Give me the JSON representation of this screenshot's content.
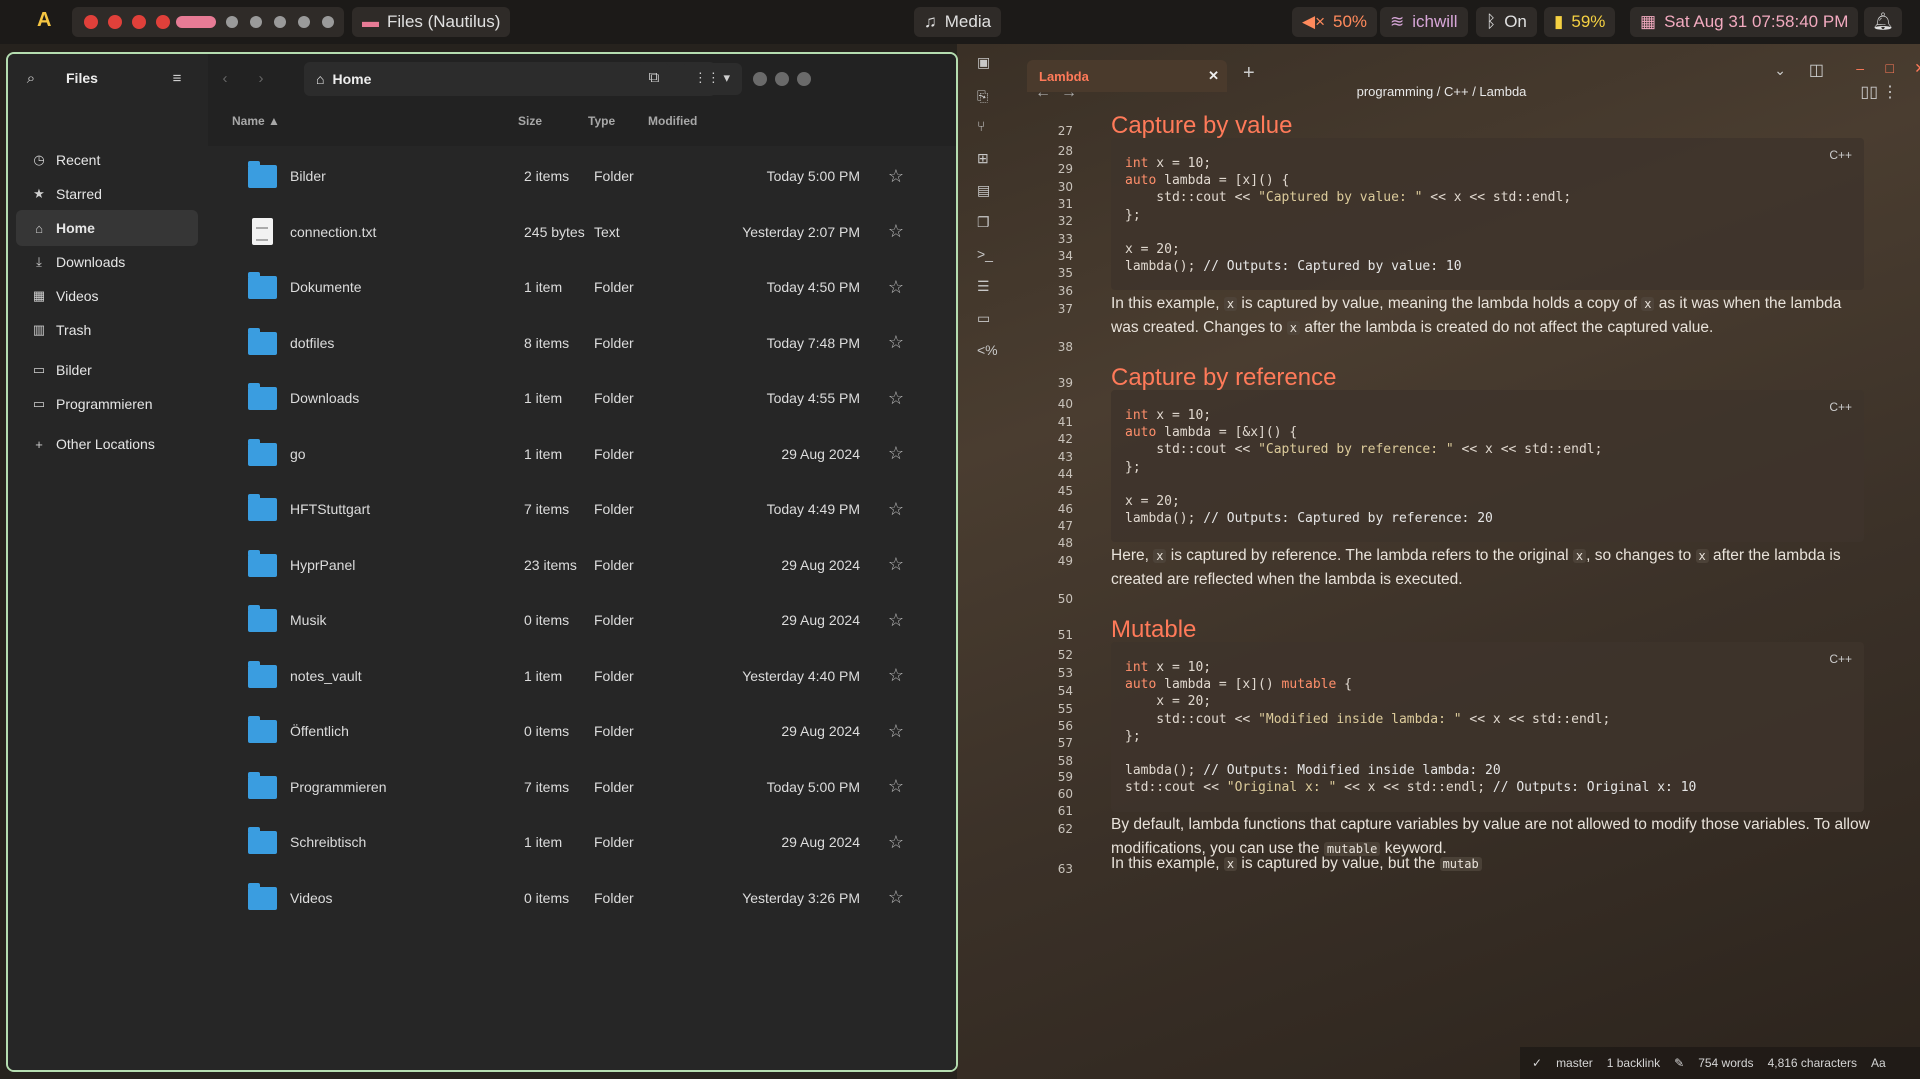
{
  "topbar": {
    "launcher": "A",
    "window_title": "Files (Nautilus)",
    "media": "Media",
    "volume": "50%",
    "wifi": "ichwill",
    "bluetooth": "On",
    "battery": "59%",
    "datetime": "Sat Aug 31  07:58:40 PM",
    "colors": {
      "red": "#e0403a",
      "pink": "#e77b95",
      "gray": "#9a9a9a"
    }
  },
  "files": {
    "title": "Files",
    "path": "Home",
    "sidebar": [
      {
        "label": "Recent",
        "icon": "clock-icon"
      },
      {
        "label": "Starred",
        "icon": "star-icon"
      },
      {
        "label": "Home",
        "icon": "home-icon"
      },
      {
        "label": "Downloads",
        "icon": "download-icon"
      },
      {
        "label": "Videos",
        "icon": "video-icon"
      },
      {
        "label": "Trash",
        "icon": "trash-icon"
      },
      {
        "label": "Bilder",
        "icon": "bookmark-folder-icon"
      },
      {
        "label": "Programmieren",
        "icon": "bookmark-folder-icon"
      },
      {
        "label": "Other Locations",
        "icon": "plus-icon"
      }
    ],
    "columns": {
      "name": "Name",
      "size": "Size",
      "type": "Type",
      "modified": "Modified"
    },
    "rows": [
      {
        "name": "Bilder",
        "size": "2 items",
        "type": "Folder",
        "modified": "Today 5:00 PM"
      },
      {
        "name": "connection.txt",
        "size": "245 bytes",
        "type": "Text",
        "modified": "Yesterday 2:07 PM"
      },
      {
        "name": "Dokumente",
        "size": "1 item",
        "type": "Folder",
        "modified": "Today 4:50 PM"
      },
      {
        "name": "dotfiles",
        "size": "8 items",
        "type": "Folder",
        "modified": "Today 7:48 PM"
      },
      {
        "name": "Downloads",
        "size": "1 item",
        "type": "Folder",
        "modified": "Today 4:55 PM"
      },
      {
        "name": "go",
        "size": "1 item",
        "type": "Folder",
        "modified": "29 Aug 2024"
      },
      {
        "name": "HFTStuttgart",
        "size": "7 items",
        "type": "Folder",
        "modified": "Today 4:49 PM"
      },
      {
        "name": "HyprPanel",
        "size": "23 items",
        "type": "Folder",
        "modified": "29 Aug 2024"
      },
      {
        "name": "Musik",
        "size": "0 items",
        "type": "Folder",
        "modified": "29 Aug 2024"
      },
      {
        "name": "notes_vault",
        "size": "1 item",
        "type": "Folder",
        "modified": "Yesterday 4:40 PM"
      },
      {
        "name": "Öffentlich",
        "size": "0 items",
        "type": "Folder",
        "modified": "29 Aug 2024"
      },
      {
        "name": "Programmieren",
        "size": "7 items",
        "type": "Folder",
        "modified": "Today 5:00 PM"
      },
      {
        "name": "Schreibtisch",
        "size": "1 item",
        "type": "Folder",
        "modified": "29 Aug 2024"
      },
      {
        "name": "Videos",
        "size": "0 items",
        "type": "Folder",
        "modified": "Yesterday 3:26 PM"
      }
    ]
  },
  "editor": {
    "tab": "Lambda",
    "breadcrumb": "programming / C++ / Lambda",
    "lang": "C++",
    "h_value": "Capture by value",
    "h_ref": "Capture by reference",
    "h_mut": "Mutable",
    "code_value": [
      "int x = 10;",
      "auto lambda = [x]() {",
      "    std::cout << \"Captured by value: \" << x << std::endl;",
      "};",
      "",
      "x = 20;",
      "lambda(); // Outputs: Captured by value: 10"
    ],
    "code_ref": [
      "int x = 10;",
      "auto lambda = [&x]() {",
      "    std::cout << \"Captured by reference: \" << x << std::endl;",
      "};",
      "",
      "x = 20;",
      "lambda(); // Outputs: Captured by reference: 20"
    ],
    "code_mut": [
      "int x = 10;",
      "auto lambda = [x]() mutable {",
      "    x = 20;",
      "    std::cout << \"Modified inside lambda: \" << x << std::endl;",
      "};",
      "",
      "lambda(); // Outputs: Modified inside lambda: 20",
      "std::cout << \"Original x: \" << x << std::endl; // Outputs: Original x: 10"
    ],
    "p_value": [
      "In this example, ",
      "x",
      " is captured by value, meaning the lambda holds a copy of ",
      "x",
      " as it was when the lambda was created. Changes to ",
      "x",
      " after the lambda is created do not affect the captured value."
    ],
    "p_ref": [
      "Here, ",
      "x",
      " is captured by reference. The lambda refers to the original ",
      "x",
      ", so changes to ",
      "x",
      " after the lambda is created are reflected when the lambda is executed."
    ],
    "p_mut": [
      "By default, lambda functions that capture variables by value are not allowed to modify those variables. To allow modifications, you can use the ",
      "mutable",
      " keyword."
    ],
    "p_last": [
      "In this example, ",
      "x",
      " is captured by value, but the ",
      "mutab"
    ],
    "line_numbers": [
      "27",
      "28",
      "29",
      "30",
      "31",
      "32",
      "33",
      "34",
      "35",
      "36",
      "37",
      "38",
      "39",
      "40",
      "41",
      "42",
      "43",
      "44",
      "45",
      "46",
      "47",
      "48",
      "49",
      "50",
      "51",
      "52",
      "53",
      "54",
      "55",
      "56",
      "57",
      "58",
      "59",
      "60",
      "61",
      "62",
      "63"
    ],
    "status": {
      "branch": "master",
      "backlinks": "1 backlink",
      "words": "754 words",
      "chars": "4,816 characters",
      "font": "Aa"
    }
  }
}
